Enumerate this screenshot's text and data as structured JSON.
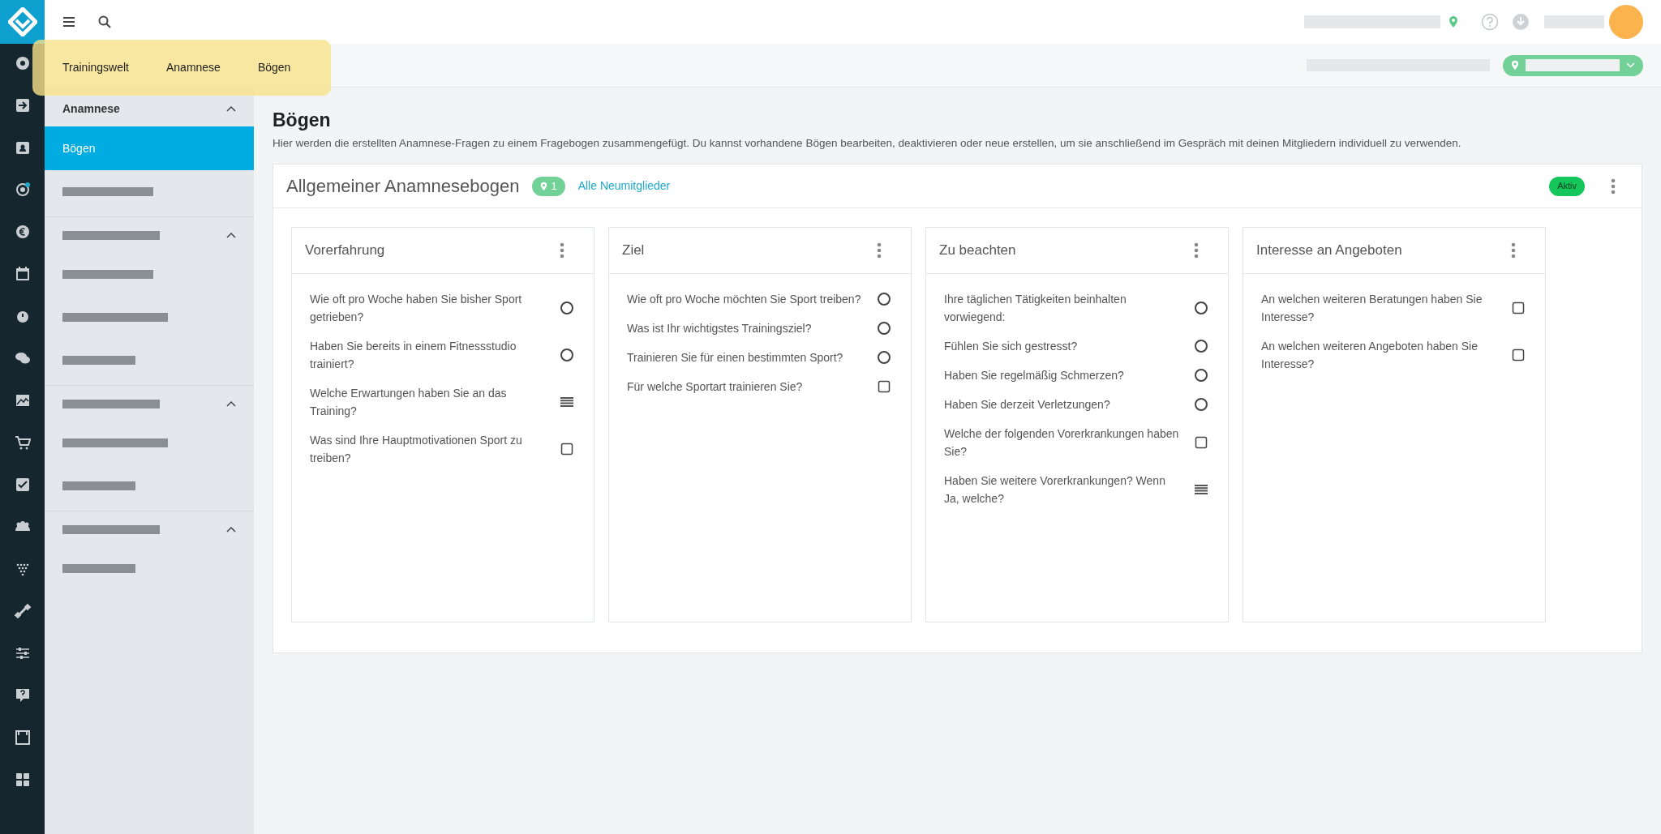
{
  "breadcrumb": [
    "Trainingswelt",
    "Anamnese",
    "Bögen"
  ],
  "sidebar": {
    "groups": [
      {
        "kind": "titled",
        "title": "Anamnese",
        "expanded": true,
        "items": [
          {
            "kind": "text",
            "label": "Bögen",
            "selected": true
          },
          {
            "kind": "redacted",
            "selected": false
          }
        ]
      },
      {
        "kind": "redacted",
        "expanded": true,
        "items": [
          {
            "kind": "redacted",
            "selected": false
          },
          {
            "kind": "redacted",
            "selected": false
          },
          {
            "kind": "redacted",
            "selected": false
          }
        ]
      },
      {
        "kind": "redacted",
        "expanded": true,
        "items": [
          {
            "kind": "redacted",
            "selected": false
          },
          {
            "kind": "redacted",
            "selected": false
          }
        ]
      },
      {
        "kind": "redacted",
        "expanded": true,
        "items": [
          {
            "kind": "redacted",
            "selected": false
          }
        ]
      }
    ]
  },
  "page": {
    "title": "Bögen",
    "description": "Hier werden die erstellten Anamnese-Fragen zu einem Fragebogen zusammengefügt. Du kannst vorhandene Bögen bearbeiten, deaktivieren oder neue erstellen, um sie anschließend im Gespräch mit deinen Mitgliedern individuell zu verwenden."
  },
  "questionnaire": {
    "title": "Allgemeiner Anamnesebogen",
    "location_count": "1",
    "audience": "Alle Neumitglieder",
    "status": "Aktiv",
    "sections": [
      {
        "title": "Vorerfahrung",
        "questions": [
          {
            "text": "Wie oft pro Woche haben Sie bisher Sport getrieben?",
            "kind": "radio"
          },
          {
            "text": "Haben Sie bereits in einem Fitnessstudio trainiert?",
            "kind": "radio"
          },
          {
            "text": "Welche Erwartungen haben Sie an das Training?",
            "kind": "text"
          },
          {
            "text": "Was sind Ihre Hauptmotivationen Sport zu treiben?",
            "kind": "checkbox"
          }
        ]
      },
      {
        "title": "Ziel",
        "questions": [
          {
            "text": "Wie oft pro Woche möchten Sie Sport treiben?",
            "kind": "radio"
          },
          {
            "text": "Was ist Ihr wichtigstes Trainingsziel?",
            "kind": "radio"
          },
          {
            "text": "Trainieren Sie für einen bestimmten Sport?",
            "kind": "radio"
          },
          {
            "text": "Für welche Sportart trainieren Sie?",
            "kind": "checkbox"
          }
        ]
      },
      {
        "title": "Zu beachten",
        "questions": [
          {
            "text": "Ihre täglichen Tätigkeiten beinhalten vorwiegend:",
            "kind": "radio"
          },
          {
            "text": "Fühlen Sie sich gestresst?",
            "kind": "radio"
          },
          {
            "text": "Haben Sie regelmäßig Schmerzen?",
            "kind": "radio"
          },
          {
            "text": "Haben Sie derzeit Verletzungen?",
            "kind": "radio"
          },
          {
            "text": "Welche der folgenden Vorerkrankungen haben Sie?",
            "kind": "checkbox"
          },
          {
            "text": "Haben Sie weitere Vorerkrankungen? Wenn Ja, welche?",
            "kind": "text"
          }
        ]
      },
      {
        "title": "Interesse an Angeboten",
        "questions": [
          {
            "text": "An welchen weiteren Beratungen haben Sie Interesse?",
            "kind": "checkbox"
          },
          {
            "text": "An welchen weiteren Angeboten haben Sie Interesse?",
            "kind": "checkbox"
          }
        ]
      }
    ]
  }
}
